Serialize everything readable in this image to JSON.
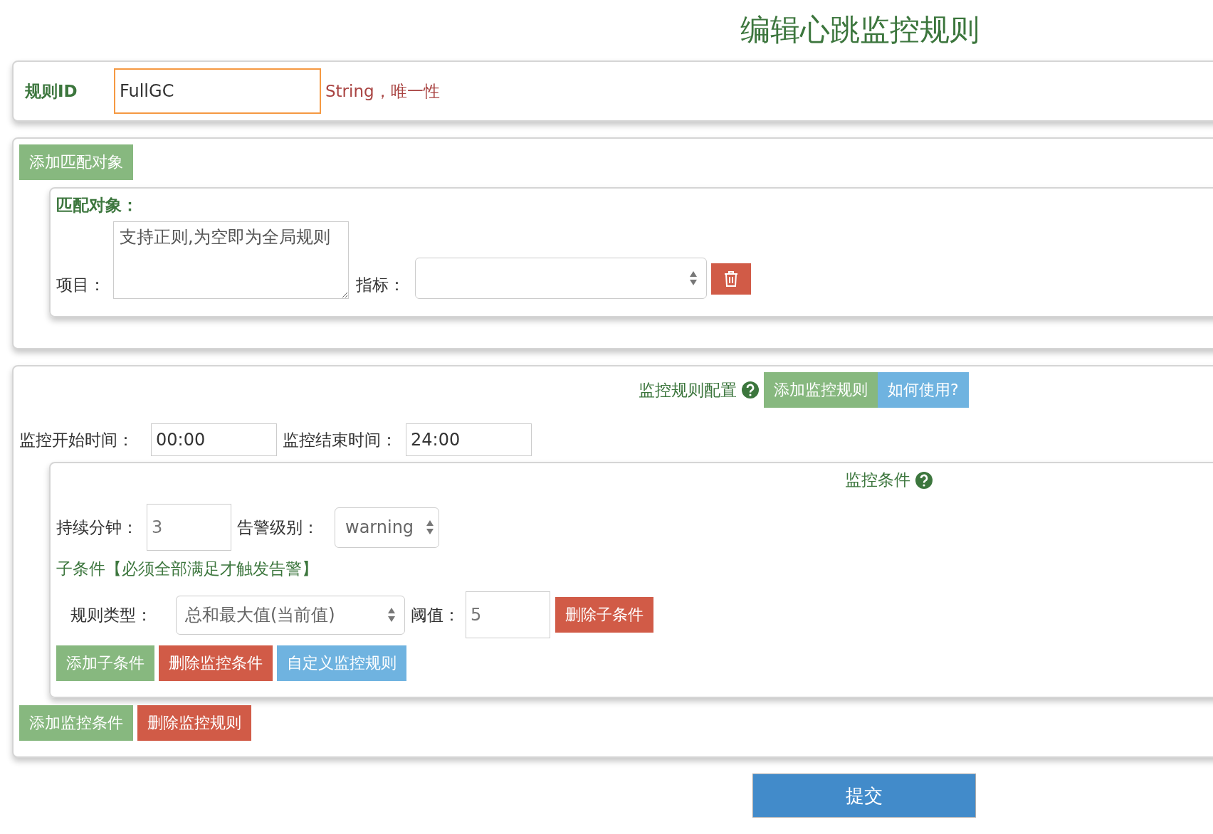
{
  "title": "编辑心跳监控规则",
  "rule_id": {
    "label": "规则ID",
    "value": "FullGC",
    "hint": "String，唯一性"
  },
  "match": {
    "add_button": {
      "label": "添加匹配对象",
      "kind": "success"
    },
    "panel_title": "匹配对象：",
    "project": {
      "label": "项目：",
      "placeholder": "支持正则,为空即为全局规则"
    },
    "metric": {
      "label": "指标："
    }
  },
  "monitor": {
    "header": "监控规则配置",
    "header_buttons": [
      {
        "label": "添加监控规则",
        "kind": "success"
      },
      {
        "label": "如何使用?",
        "kind": "info"
      }
    ],
    "start": {
      "label": "监控开始时间：",
      "value": "00:00"
    },
    "end": {
      "label": "监控结束时间：",
      "value": "24:00"
    },
    "condition": {
      "title": "监控条件",
      "duration": {
        "label": "持续分钟：",
        "value": "3"
      },
      "level": {
        "label": "告警级别：",
        "value": "warning"
      },
      "sub_title": "子条件【必须全部满足才触发告警】",
      "sub_conditions": [
        {
          "type_label": "规则类型：",
          "type_value": "总和最大值(当前值)",
          "threshold_label": "阈值：",
          "threshold_value": "5",
          "delete_button": {
            "label": "删除子条件",
            "kind": "danger"
          }
        }
      ],
      "buttons": [
        {
          "label": "添加子条件",
          "kind": "success"
        },
        {
          "label": "删除监控条件",
          "kind": "danger"
        },
        {
          "label": "自定义监控规则",
          "kind": "info"
        }
      ]
    },
    "buttons": [
      {
        "label": "添加监控条件",
        "kind": "success"
      },
      {
        "label": "删除监控规则",
        "kind": "danger"
      }
    ]
  },
  "submit": {
    "label": "提交",
    "kind": "primary"
  }
}
